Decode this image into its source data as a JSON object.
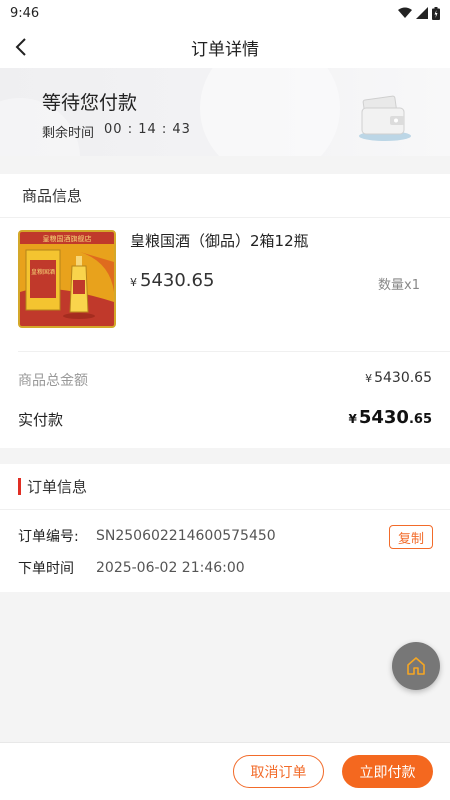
{
  "status_bar": {
    "time": "9:46"
  },
  "header": {
    "title": "订单详情"
  },
  "payment_status": {
    "title": "等待您付款",
    "remaining_label": "剩余时间",
    "countdown": "00 : 14 : 43"
  },
  "goods": {
    "section_title": "商品信息",
    "product_name": "皇粮国酒（御品）2箱12瓶",
    "currency": "¥",
    "price": "5430.65",
    "quantity": "数量x1",
    "image_banner_text": "皇粮国酒旗舰店",
    "image_bottle_text": "皇粮国酒"
  },
  "totals": {
    "total_label": "商品总金额",
    "total_currency": "¥",
    "total_value": "5430.65",
    "paid_label": "实付款",
    "paid_currency": "¥",
    "paid_int": "5430",
    "paid_dec": ".65"
  },
  "order_info": {
    "section_title": "订单信息",
    "order_no_label": "订单编号:",
    "order_no": "SN250602214600575450",
    "copy_label": "复制",
    "time_label": "下单时间",
    "time_value": "2025-06-02 21:46:00"
  },
  "actions": {
    "cancel_label": "取消订单",
    "pay_label": "立即付款"
  },
  "colors": {
    "accent": "#f4681f",
    "red_bar": "#e02e24"
  }
}
